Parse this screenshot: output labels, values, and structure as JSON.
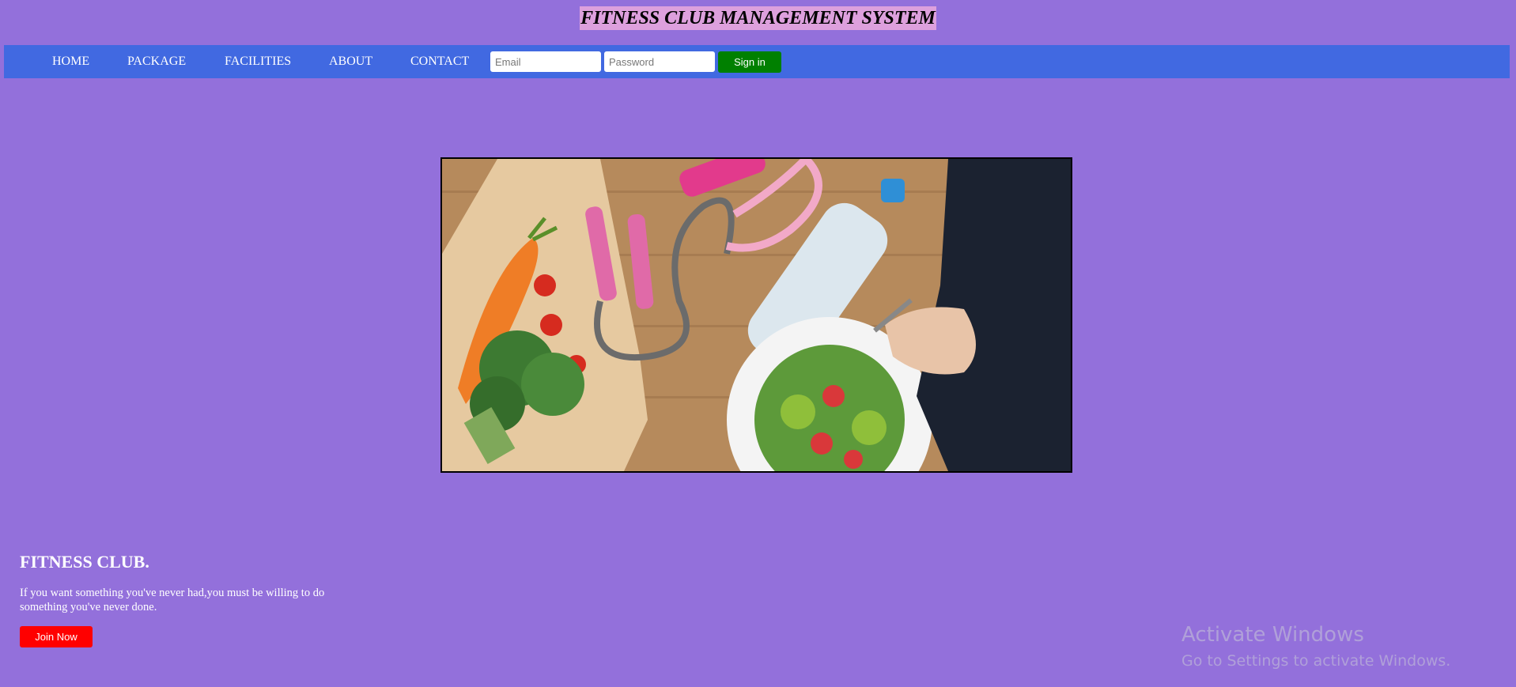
{
  "header": {
    "title": "FITNESS CLUB MANAGEMENT SYSTEM"
  },
  "nav": {
    "items": [
      {
        "label": "HOME"
      },
      {
        "label": "PACKAGE"
      },
      {
        "label": "FACILITIES"
      },
      {
        "label": "ABOUT"
      },
      {
        "label": "CONTACT"
      }
    ],
    "email_placeholder": "Email",
    "email_value": "",
    "password_placeholder": "Password",
    "password_value": "",
    "signin_label": "Sign in"
  },
  "hero": {
    "image_subject": "fitness-diet-photo"
  },
  "footer": {
    "heading": "FITNESS CLUB.",
    "quote": "If you want something you've never had,you must be willing to do something you've never done.",
    "join_label": "Join Now"
  },
  "watermark": {
    "title": "Activate Windows",
    "subtitle": "Go to Settings to activate Windows."
  },
  "colors": {
    "page_background": "#9370db",
    "navbar": "#4169e1",
    "title_highlight": "#dda0dd",
    "signin_button": "#008000",
    "join_button": "#ff0000"
  }
}
